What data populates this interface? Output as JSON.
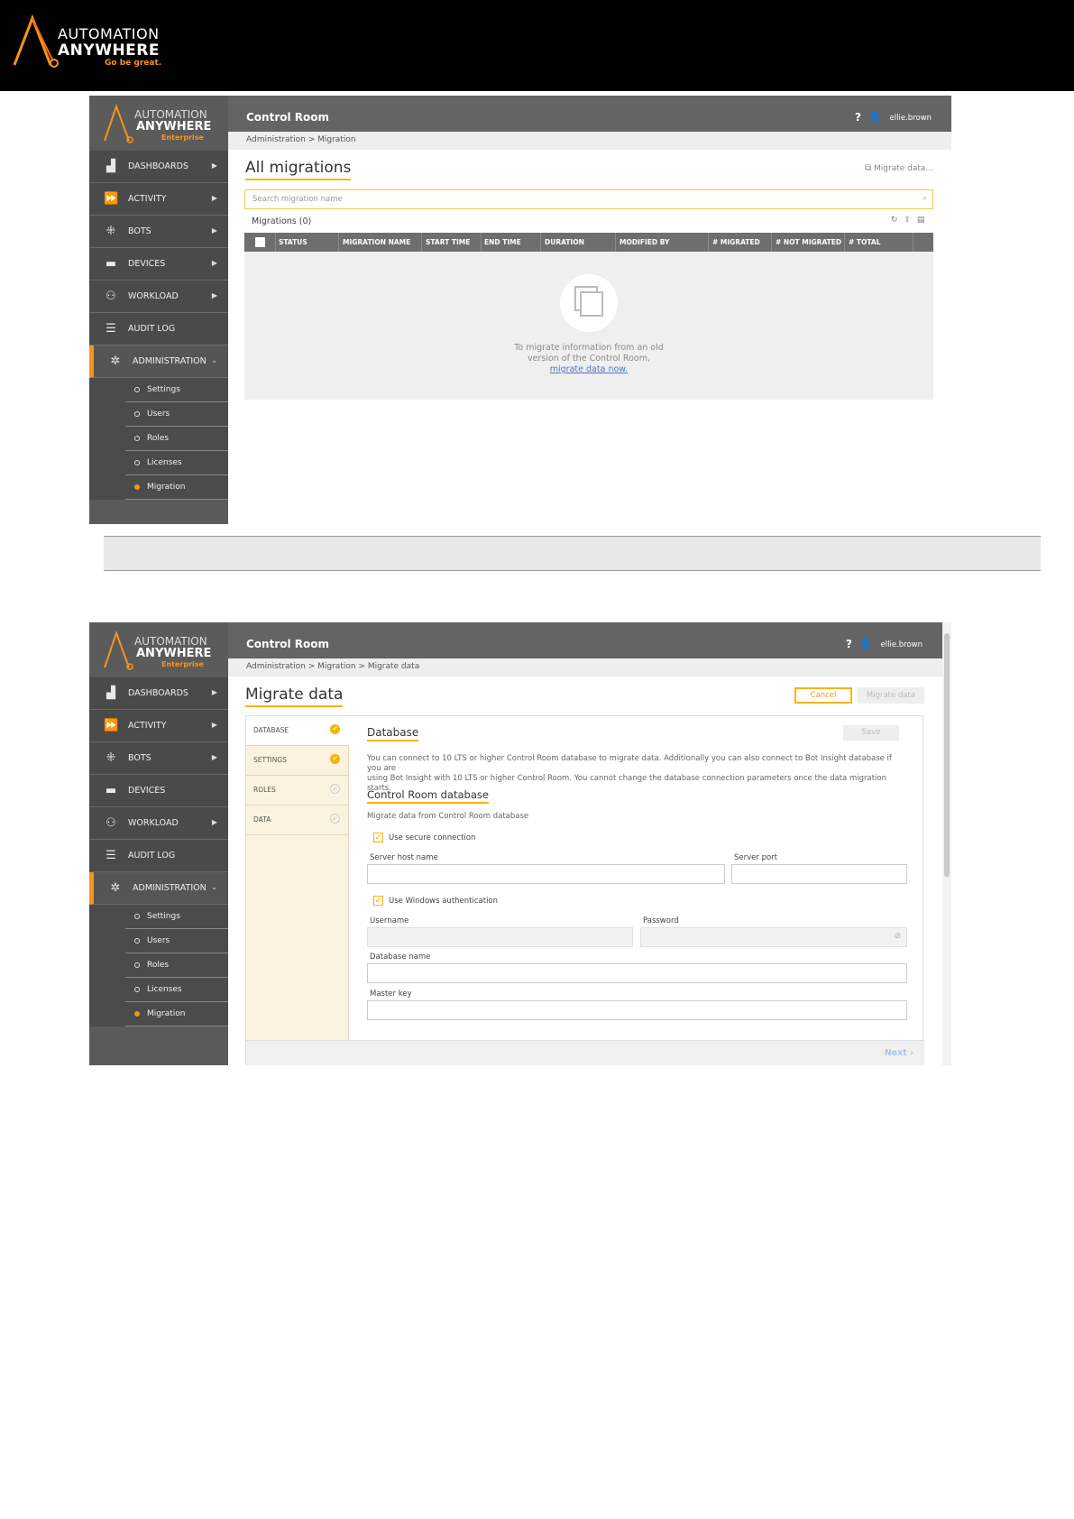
{
  "doc_header": {
    "logo_line1": "AUTOMATION",
    "logo_line2": "ANYWHERE",
    "logo_tagline": "Go be great."
  },
  "app": {
    "logo_line1": "AUTOMATION",
    "logo_line2": "ANYWHERE",
    "logo_line3": "Enterprise",
    "title": "Control Room",
    "help": "?",
    "username": "ellie.brown"
  },
  "nav": [
    {
      "label": "DASHBOARDS",
      "icon": "dashboard-icon"
    },
    {
      "label": "ACTIVITY",
      "icon": "activity-icon"
    },
    {
      "label": "BOTS",
      "icon": "bots-icon"
    },
    {
      "label": "DEVICES",
      "icon": "devices-icon"
    },
    {
      "label": "WORKLOAD",
      "icon": "workload-icon"
    },
    {
      "label": "AUDIT LOG",
      "icon": "audit-log-icon"
    },
    {
      "label": "ADMINISTRATION",
      "icon": "administration-icon"
    }
  ],
  "subnav": [
    "Settings",
    "Users",
    "Roles",
    "Licenses",
    "Migration"
  ],
  "screen1": {
    "breadcrumb": "Administration  >  Migration",
    "heading": "All migrations",
    "migrate_link": "Migrate data...",
    "search_placeholder": "Search migration name",
    "count_label": "Migrations (0)",
    "columns": [
      "STATUS",
      "MIGRATION NAME",
      "START TIME",
      "END TIME",
      "DURATION",
      "MODIFIED BY",
      "# MIGRATED",
      "# NOT MIGRATED",
      "# TOTAL"
    ],
    "empty_line1": "To migrate information from an old",
    "empty_line2": "version of the Control Room,",
    "empty_link": "migrate data now."
  },
  "screen2": {
    "breadcrumb": "Administration  >  Migration  >  Migrate data",
    "heading": "Migrate data",
    "cancel": "Cancel",
    "migrate": "Migrate data",
    "steps": [
      {
        "label": "DATABASE",
        "done": true
      },
      {
        "label": "SETTINGS",
        "done": true
      },
      {
        "label": "ROLES",
        "done": false
      },
      {
        "label": "DATA",
        "done": false
      }
    ],
    "section_title": "Database",
    "save": "Save",
    "intro_line1": "You can connect to 10 LTS or higher Control Room database to migrate data. Additionally you can also connect to Bot Insight database if you are",
    "intro_line2": "using Bot Insight with 10 LTS or higher Control Room. You cannot change the database connection parameters once the data migration starts.",
    "sub_title": "Control Room database",
    "sub_text": "Migrate data from Control Room database",
    "secure_label": "Use secure connection",
    "host_label": "Server host name",
    "port_label": "Server port",
    "windows_auth_label": "Use Windows authentication",
    "username_label": "Username",
    "password_label": "Password",
    "dbname_label": "Database name",
    "masterkey_label": "Master key",
    "next": "Next ›"
  }
}
